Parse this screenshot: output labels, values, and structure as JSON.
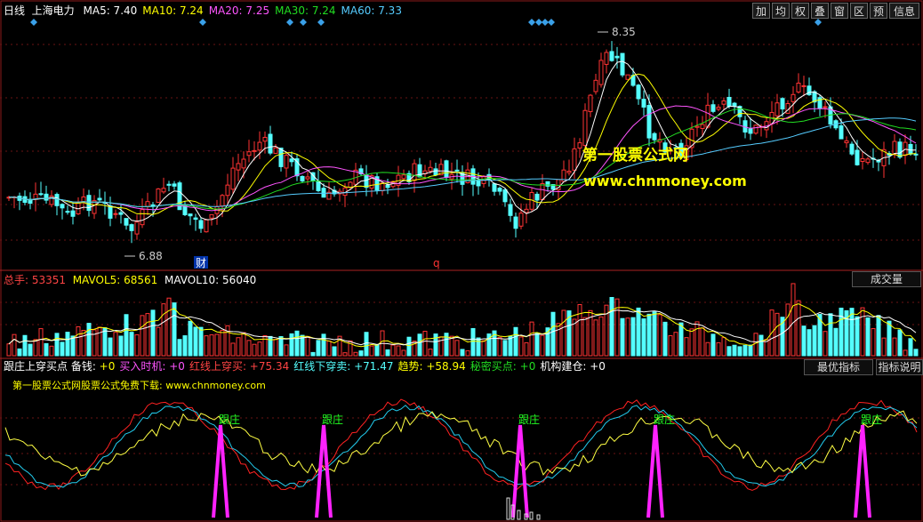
{
  "header": {
    "period": "日线",
    "stock_name": "上海电力",
    "ma": [
      {
        "label": "MA5: 7.40",
        "color": "#ffffff"
      },
      {
        "label": "MA10: 7.24",
        "color": "#ffff00"
      },
      {
        "label": "MA20: 7.25",
        "color": "#ff55ff"
      },
      {
        "label": "MA30: 7.24",
        "color": "#22dd22"
      },
      {
        "label": "MA60: 7.33",
        "color": "#55ccff"
      }
    ]
  },
  "toolbar": [
    "加",
    "均",
    "权",
    "叠",
    "窗",
    "区",
    "预",
    "信息"
  ],
  "price_panel": {
    "high_label": "8.35",
    "low_label": "6.88",
    "marker_cai": "财",
    "marker_q": "q",
    "up_color": "#ff3333",
    "down_color": "#54ffff"
  },
  "watermark": {
    "line1": "第一股票公式网",
    "line2": "www.chnmoney.com"
  },
  "volume_panel": {
    "total": {
      "label": "总手:",
      "value": "53351"
    },
    "mavol5": {
      "label": "MAVOL5:",
      "value": "68561"
    },
    "mavol10": {
      "label": "MAVOL10:",
      "value": "56040"
    },
    "tab": "成交量"
  },
  "indicator_panel": {
    "items": [
      {
        "label": "跟庄上穿买点 备钱:",
        "value": "+0",
        "lc": "#ffffff",
        "vc": "#ffff00"
      },
      {
        "label": "买入时机:",
        "value": "+0",
        "lc": "#ff55ff",
        "vc": "#ff55ff"
      },
      {
        "label": "红线上穿买:",
        "value": "+75.34",
        "lc": "#ff4444",
        "vc": "#ff4444"
      },
      {
        "label": "红线下穿卖:",
        "value": "+71.47",
        "lc": "#54ffff",
        "vc": "#54ffff"
      },
      {
        "label": "趋势:",
        "value": "+58.94",
        "lc": "#ffff00",
        "vc": "#ffff00"
      },
      {
        "label": "秘密买点:",
        "value": "+0",
        "lc": "#22dd22",
        "vc": "#22dd22"
      },
      {
        "label": "机构建仓:",
        "value": "+0",
        "lc": "#ffffff",
        "vc": "#ffffff"
      }
    ],
    "note": "第一股票公式网股票公式免费下载: www.chnmoney.com",
    "tab_best": "最优指标",
    "tab_help": "指标说明",
    "signal_label": "跟庄"
  }
}
